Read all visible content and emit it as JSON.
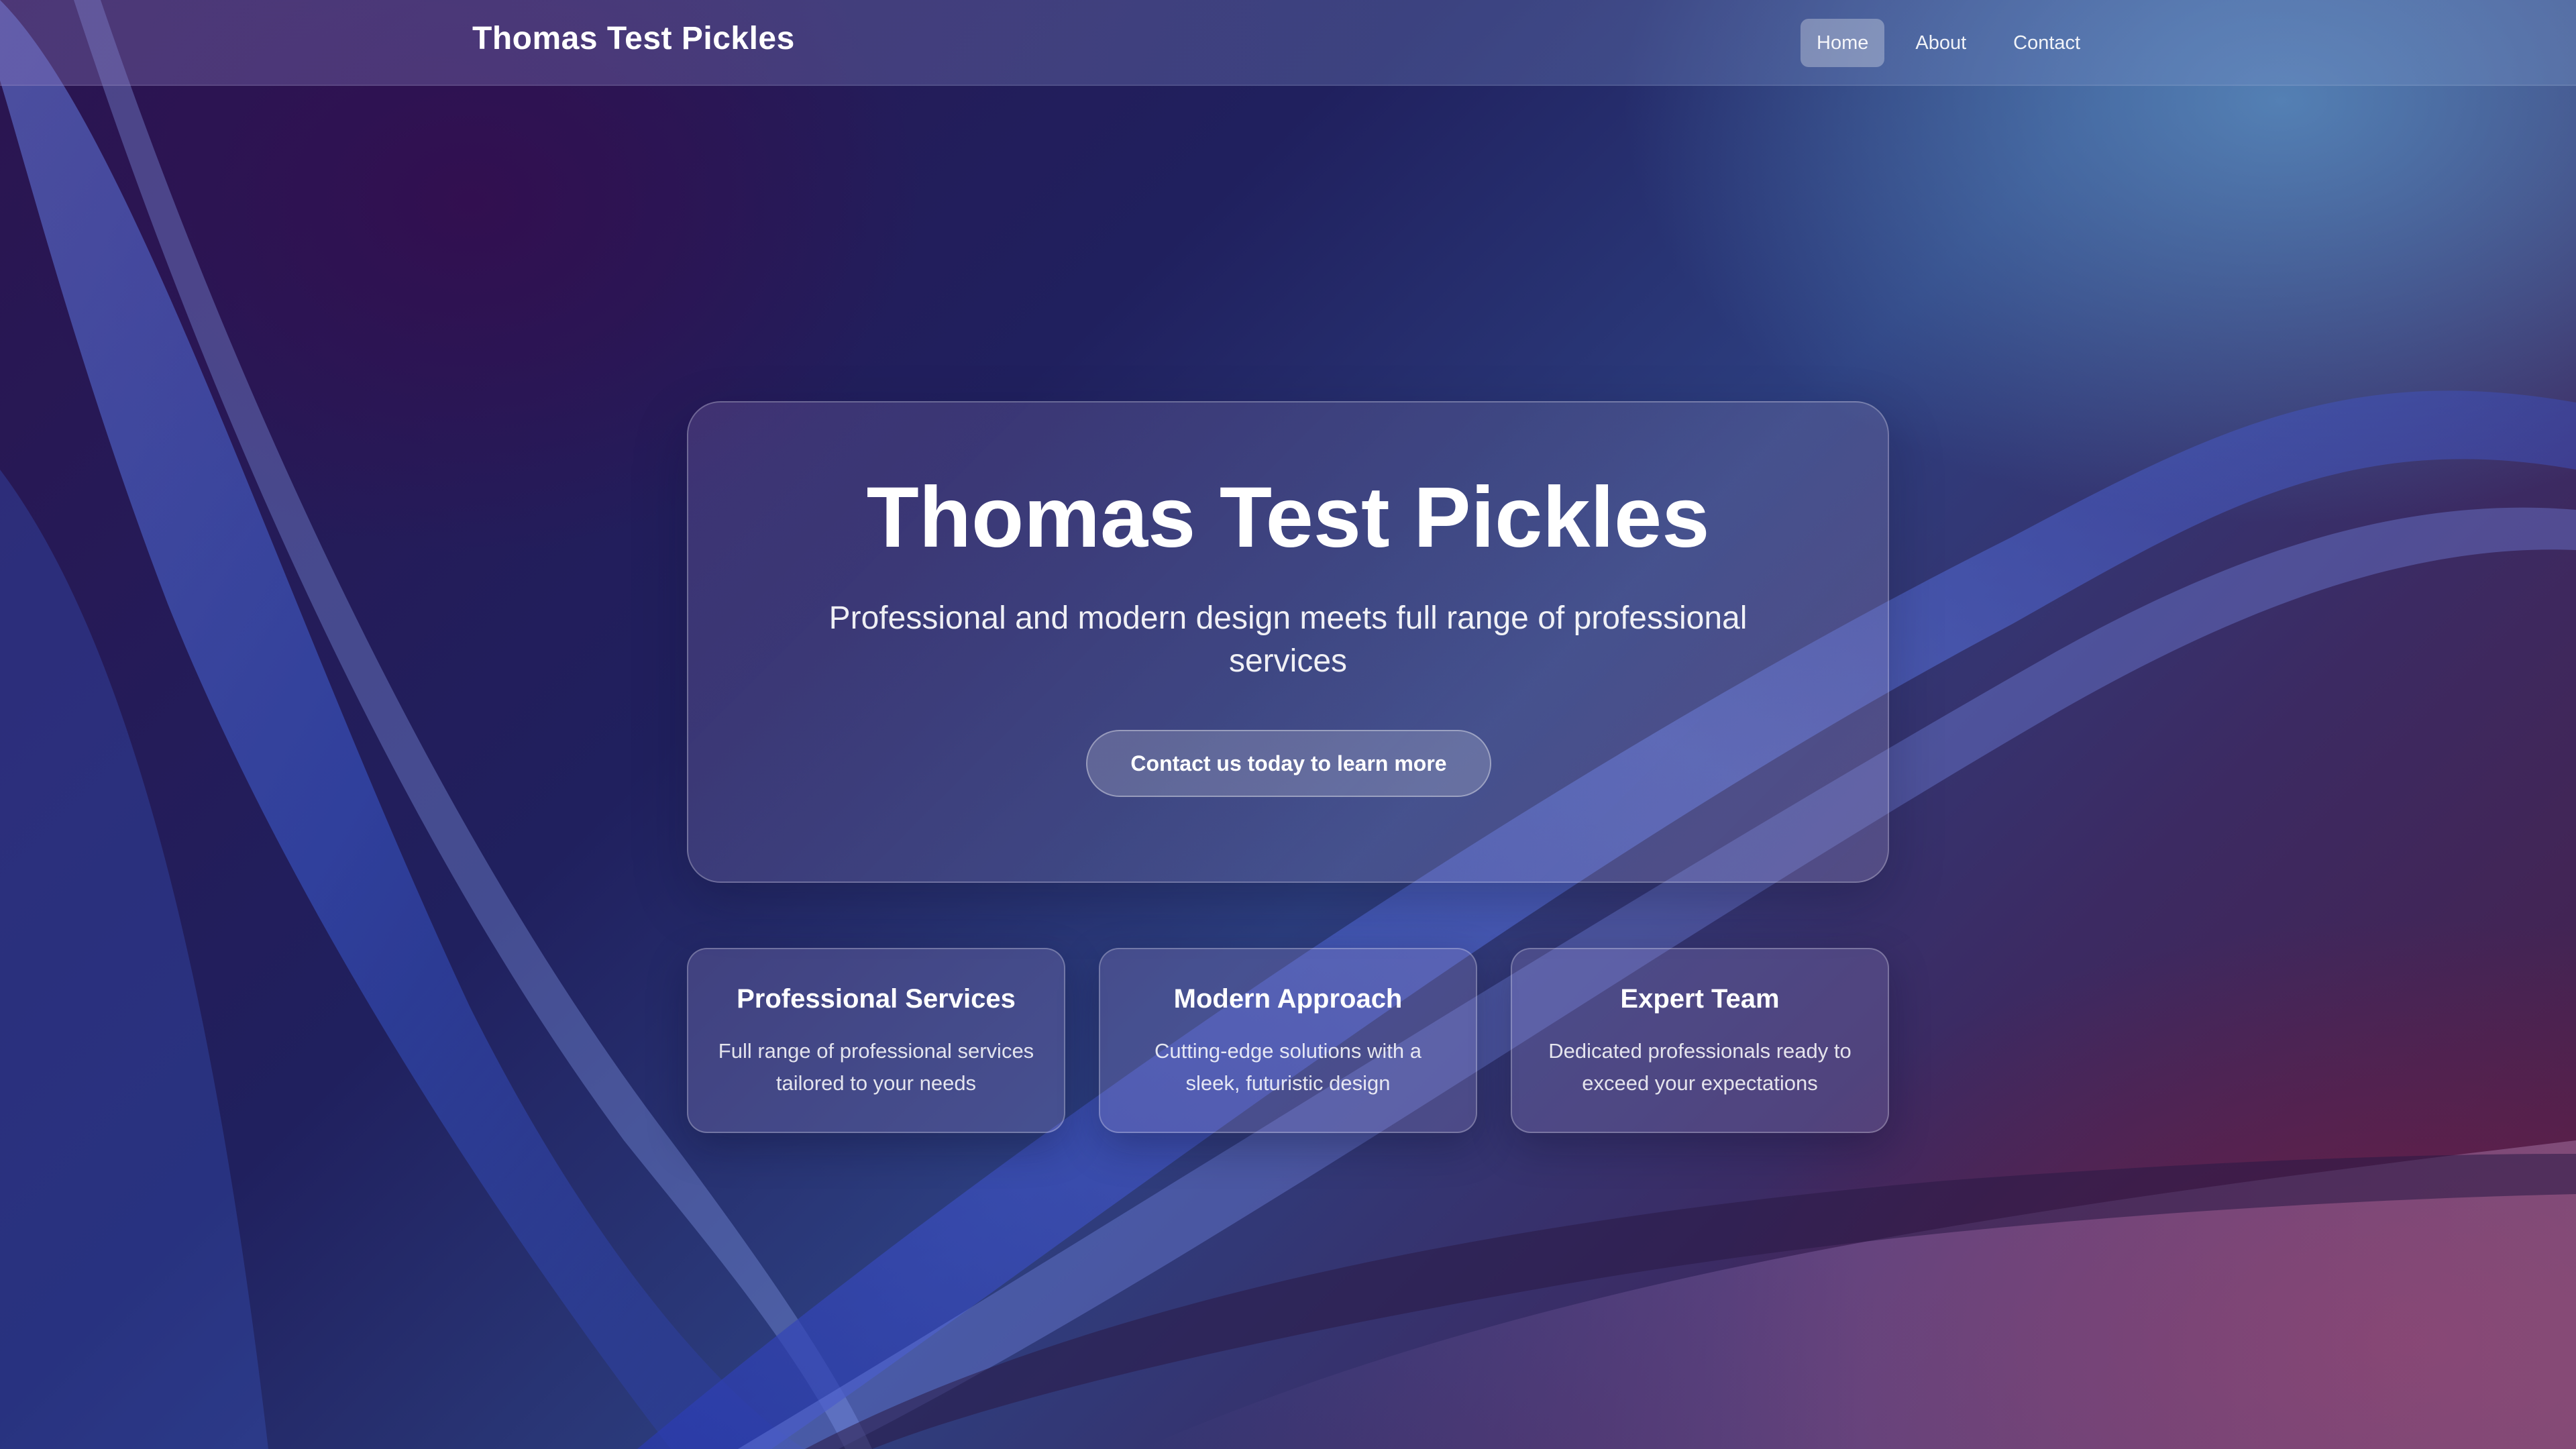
{
  "navbar": {
    "brand": "Thomas Test Pickles",
    "items": [
      {
        "label": "Home",
        "active": true
      },
      {
        "label": "About",
        "active": false
      },
      {
        "label": "Contact",
        "active": false
      }
    ]
  },
  "hero": {
    "title": "Thomas Test Pickles",
    "subtitle": "Professional and modern design meets full range of professional services",
    "cta_label": "Contact us today to learn more"
  },
  "features": [
    {
      "title": "Professional Services",
      "description": "Full range of professional services tailored to your needs"
    },
    {
      "title": "Modern Approach",
      "description": "Cutting-edge solutions with a sleek, futuristic design"
    },
    {
      "title": "Expert Team",
      "description": "Dedicated professionals ready to exceed your expectations"
    }
  ],
  "colors": {
    "background_deep": "#2b1450",
    "background_blue": "#2d3f80",
    "background_wine": "#4a1e46",
    "accent_light_blue": "#5a8cbe",
    "text": "#ffffff"
  }
}
